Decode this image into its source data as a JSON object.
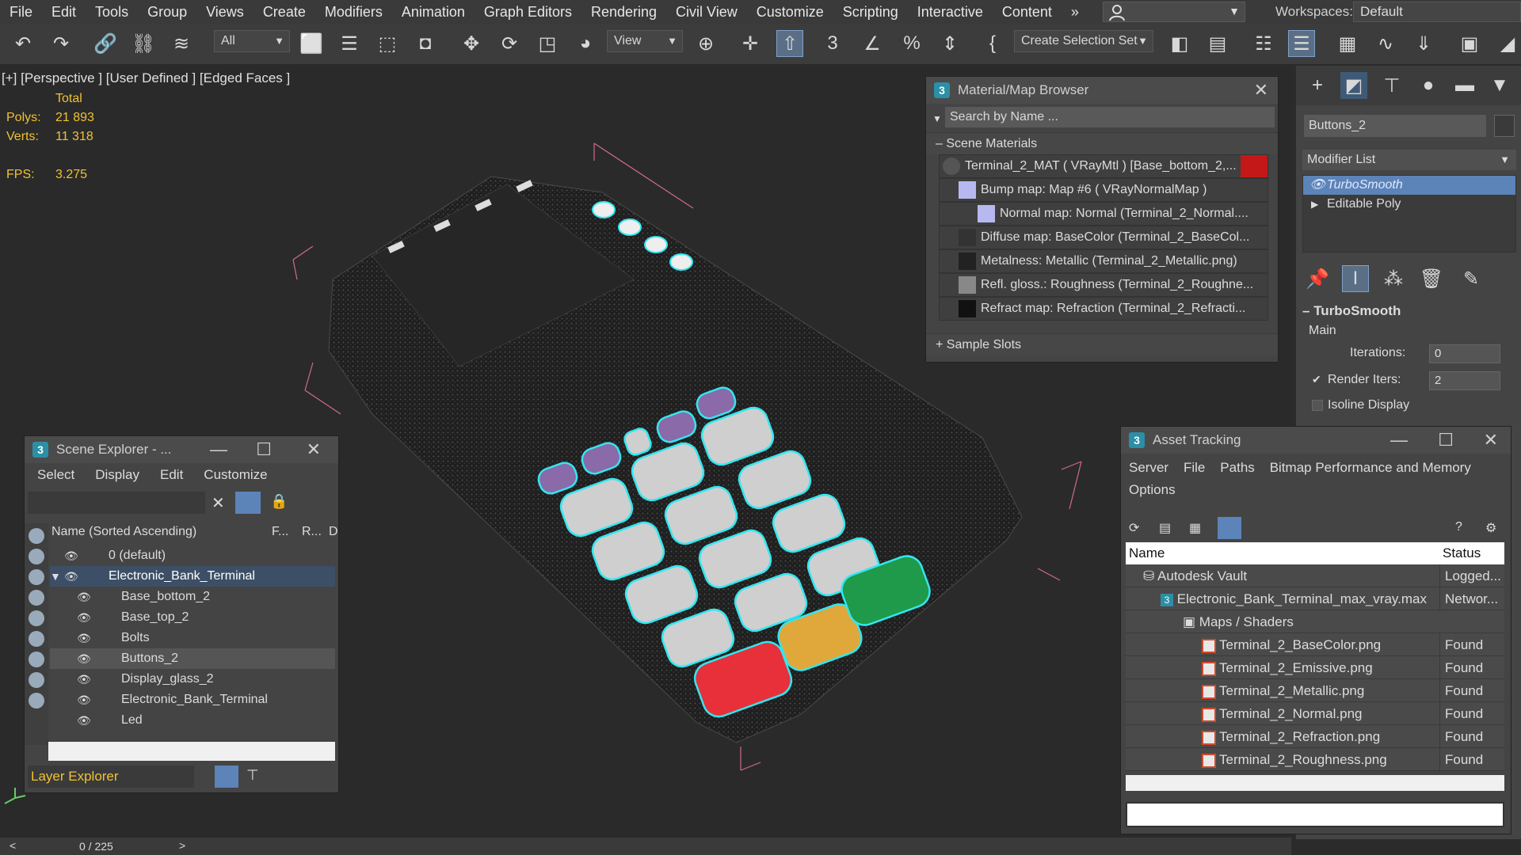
{
  "menu": [
    "File",
    "Edit",
    "Tools",
    "Group",
    "Views",
    "Create",
    "Modifiers",
    "Animation",
    "Graph Editors",
    "Rendering",
    "Civil View",
    "Customize",
    "Scripting",
    "Interactive",
    "Content"
  ],
  "menu_overflow": "»",
  "workspaces": {
    "label": "Workspaces:",
    "value": "Default"
  },
  "toolbar": {
    "filter": "All",
    "ref_coord": "View",
    "selection_set": "Create Selection Set"
  },
  "viewport": {
    "label": "[+] [Perspective ] [User Defined ] [Edged Faces ]",
    "stats": {
      "total": "Total",
      "polys_label": "Polys:",
      "polys": "21 893",
      "verts_label": "Verts:",
      "verts": "11 318",
      "fps_label": "FPS:",
      "fps": "3.275"
    }
  },
  "material_browser": {
    "title": "Material/Map Browser",
    "search_placeholder": "Search by Name ...",
    "section": "Scene Materials",
    "rows": [
      "Terminal_2_MAT  ( VRayMtl )  [Base_bottom_2,...",
      "Bump map: Map #6  ( VRayNormalMap )",
      "Normal map: Normal  (Terminal_2_Normal....",
      "Diffuse map: BaseColor  (Terminal_2_BaseCol...",
      "Metalness: Metallic (Terminal_2_Metallic.png)",
      "Refl. gloss.: Roughness (Terminal_2_Roughne...",
      "Refract map: Refraction (Terminal_2_Refracti..."
    ],
    "sample_slots": "+ Sample Slots"
  },
  "command_panel": {
    "object_name": "Buttons_2",
    "modifier_list": "Modifier List",
    "stack": [
      "TurboSmooth",
      "Editable Poly"
    ],
    "rollout_title": "TurboSmooth",
    "group": "Main",
    "iterations_label": "Iterations:",
    "iterations": "0",
    "render_iters_label": "Render Iters:",
    "render_iters": "2",
    "isoline_label": "Isoline Display"
  },
  "scene_explorer": {
    "title": "Scene Explorer - ...",
    "menu": [
      "Select",
      "Display",
      "Edit",
      "Customize"
    ],
    "col_name": "Name (Sorted Ascending)",
    "col_f": "F...",
    "col_r": "R...",
    "col_d": "D",
    "rows": [
      {
        "name": "0 (default)",
        "indent": 0
      },
      {
        "name": "Electronic_Bank_Terminal",
        "indent": 0
      },
      {
        "name": "Base_bottom_2",
        "indent": 1
      },
      {
        "name": "Base_top_2",
        "indent": 1
      },
      {
        "name": "Bolts",
        "indent": 1
      },
      {
        "name": "Buttons_2",
        "indent": 1
      },
      {
        "name": "Display_glass_2",
        "indent": 1
      },
      {
        "name": "Electronic_Bank_Terminal",
        "indent": 1
      },
      {
        "name": "Led",
        "indent": 1
      }
    ],
    "footer": "Layer Explorer"
  },
  "asset_tracking": {
    "title": "Asset Tracking",
    "menu": [
      "Server",
      "File",
      "Paths",
      "Bitmap Performance and Memory",
      "Options"
    ],
    "col_name": "Name",
    "col_status": "Status",
    "rows": [
      {
        "name": "Autodesk Vault",
        "status": "Logged...",
        "indent": 0
      },
      {
        "name": "Electronic_Bank_Terminal_max_vray.max",
        "status": "Networ...",
        "indent": 1
      },
      {
        "name": "Maps / Shaders",
        "status": "",
        "indent": 2
      },
      {
        "name": "Terminal_2_BaseColor.png",
        "status": "Found",
        "indent": 3
      },
      {
        "name": "Terminal_2_Emissive.png",
        "status": "Found",
        "indent": 3
      },
      {
        "name": "Terminal_2_Metallic.png",
        "status": "Found",
        "indent": 3
      },
      {
        "name": "Terminal_2_Normal.png",
        "status": "Found",
        "indent": 3
      },
      {
        "name": "Terminal_2_Refraction.png",
        "status": "Found",
        "indent": 3
      },
      {
        "name": "Terminal_2_Roughness.png",
        "status": "Found",
        "indent": 3
      }
    ]
  },
  "timeline": {
    "frame": "0 / 225"
  },
  "colors": {
    "selection_cyan": "#33e6f0",
    "accent_blue": "#5c84b8",
    "stat_yellow": "#f1c232",
    "key_red": "#e8303a",
    "key_yellow": "#e0a83a",
    "key_green": "#1f9a4a"
  }
}
